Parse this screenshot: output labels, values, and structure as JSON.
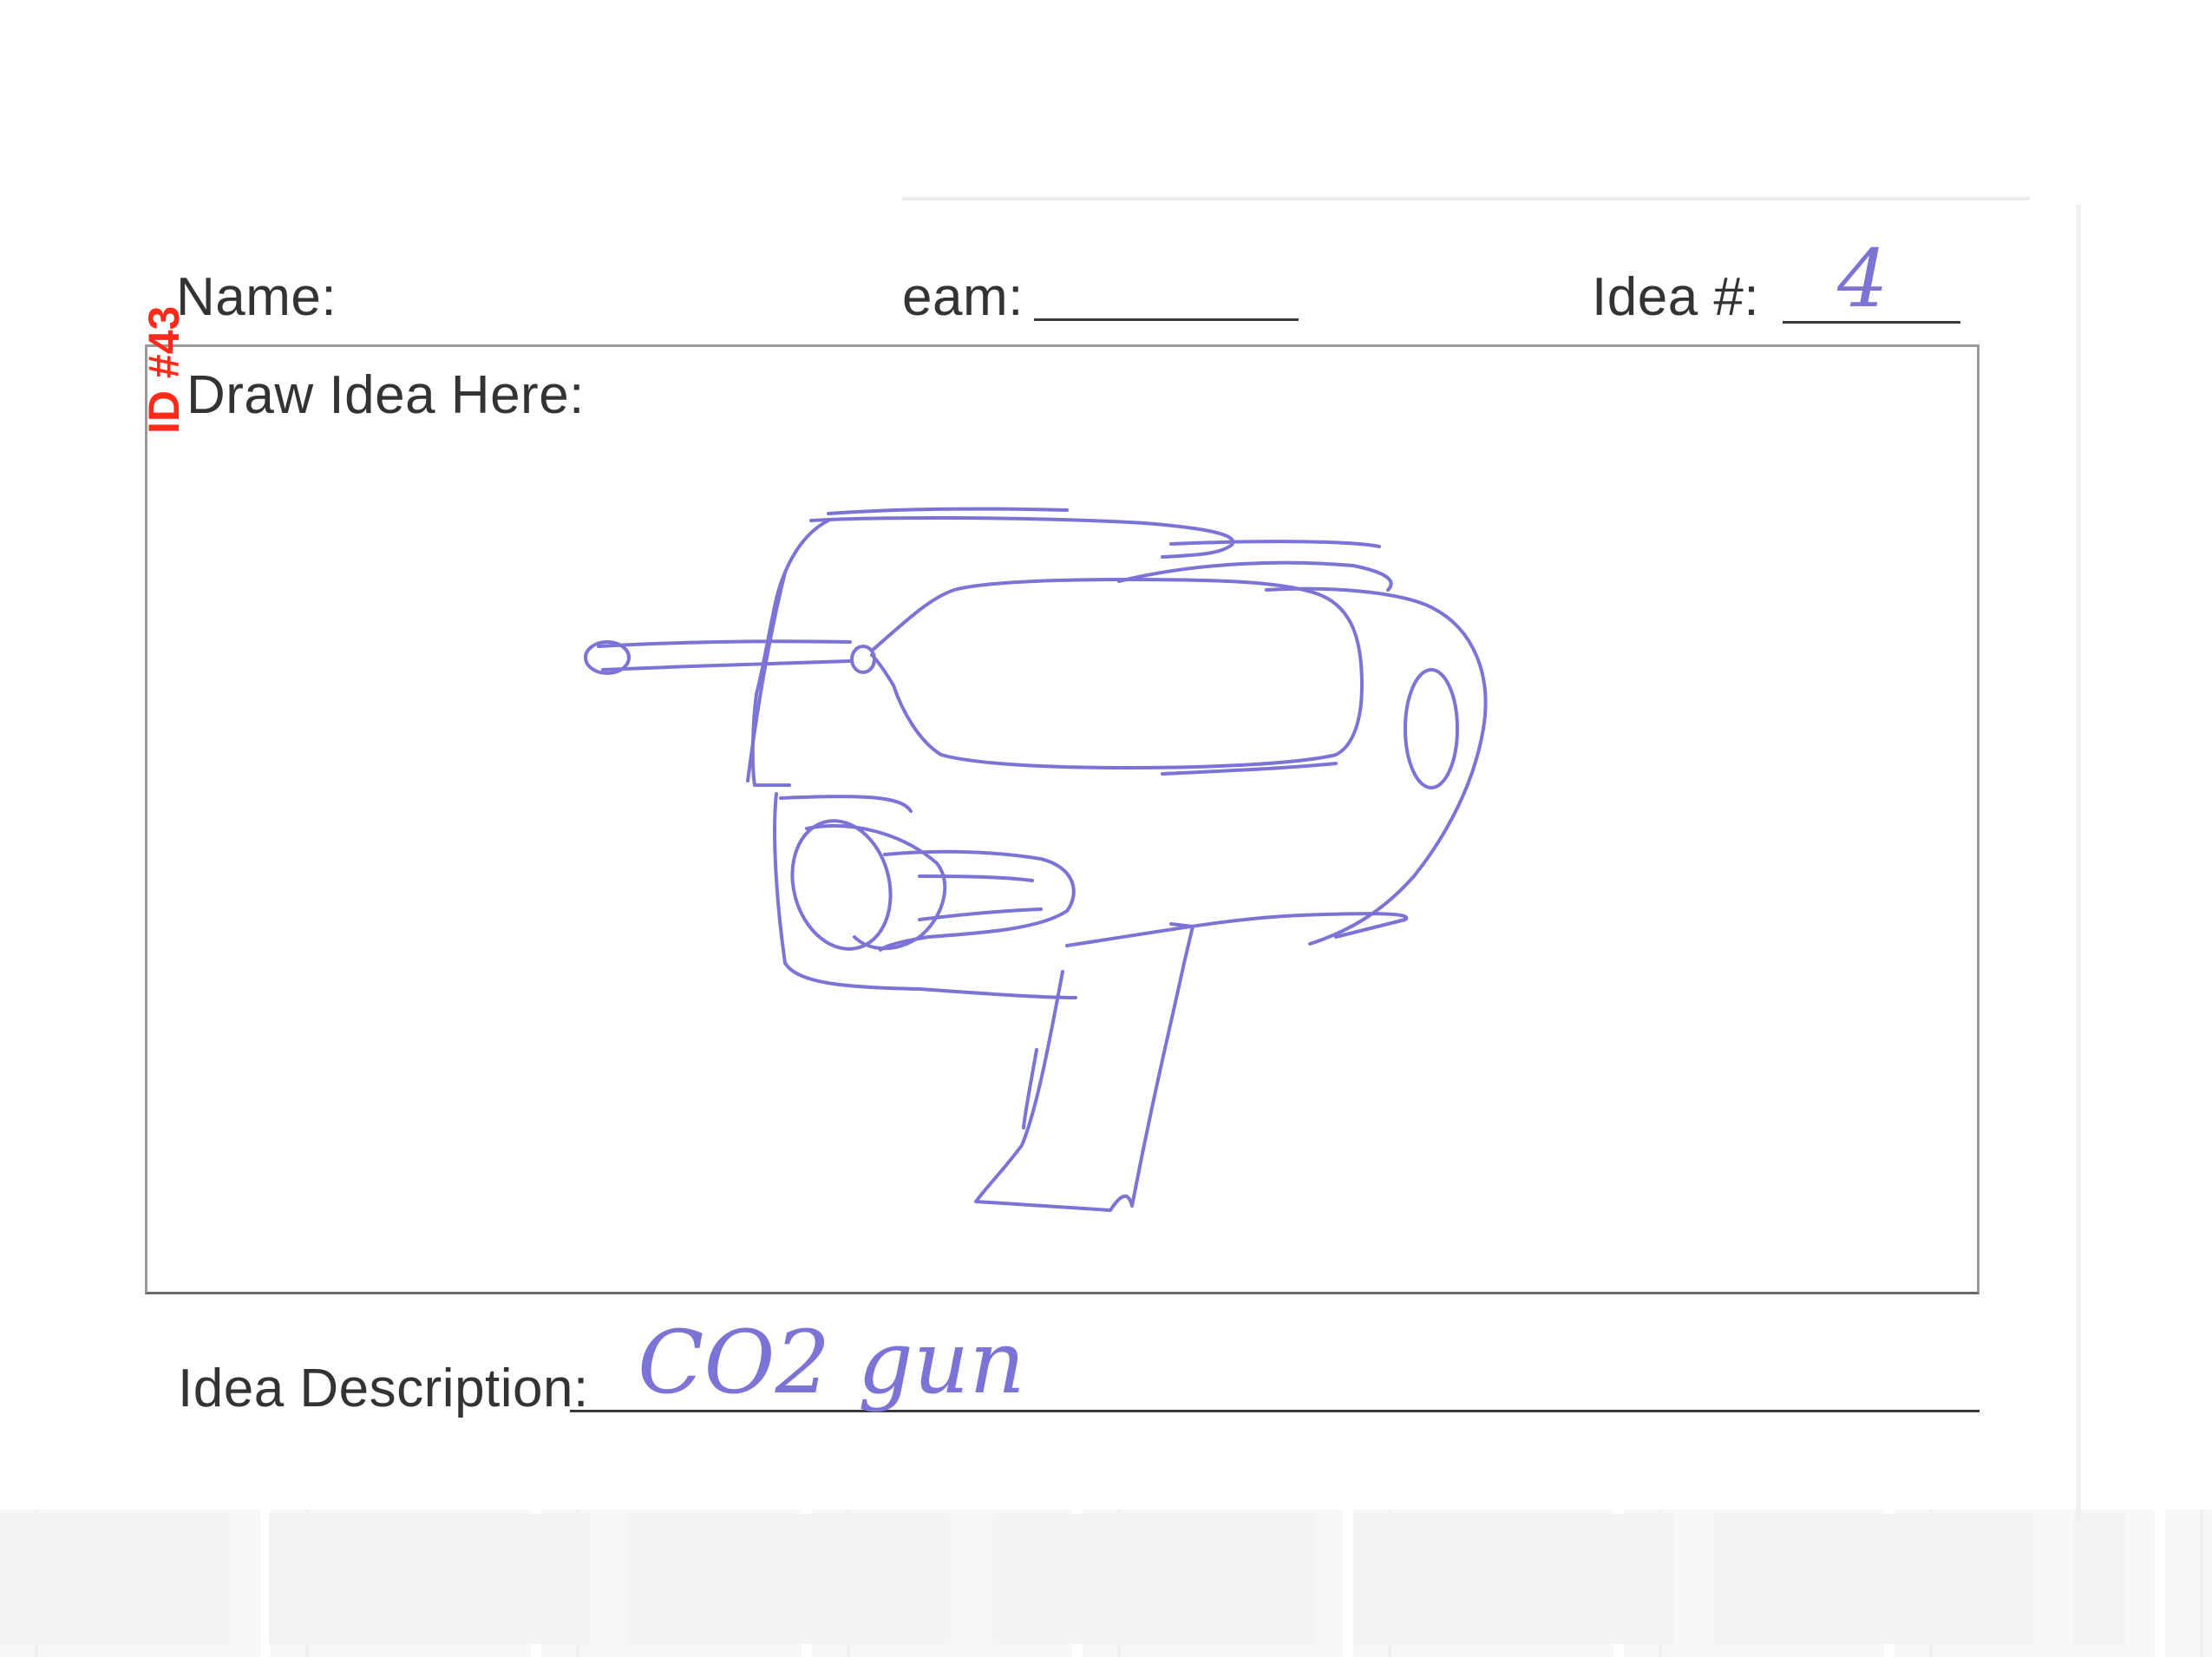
{
  "form": {
    "name_label": "Name:",
    "team_label": "eam:",
    "idea_num_label": "Idea #:",
    "idea_num_value": "4",
    "draw_label": "Draw Idea Here:",
    "description_label": "Idea Description:",
    "description_value": "CO2 gun"
  },
  "stamp": {
    "text": "ID #43",
    "color": "#ff2a1a"
  },
  "ink_color": "#7b74d6",
  "sketch": {
    "subject": "co2-gun-sketch"
  }
}
